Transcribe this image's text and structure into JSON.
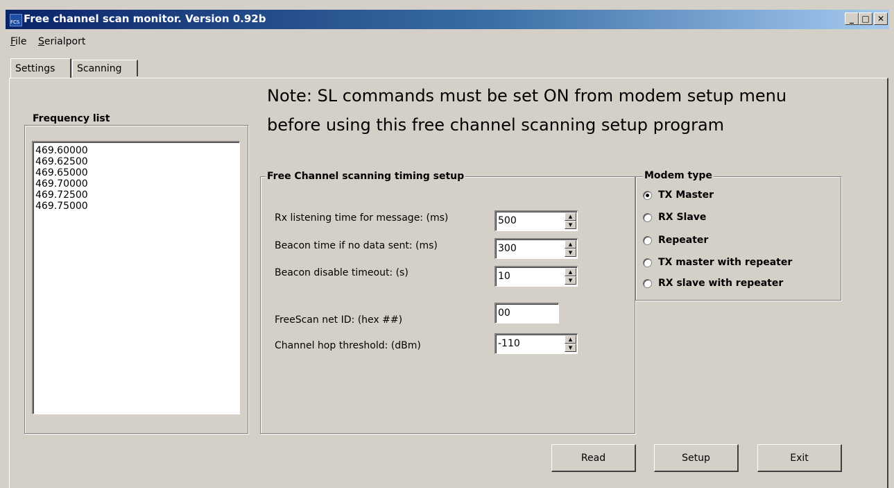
{
  "window": {
    "title": "Free channel scan monitor. Version 0.92b",
    "minimize": "_",
    "maximize": "□",
    "close": "✕"
  },
  "menu": {
    "file": "File",
    "file_accel": "F",
    "file_rest": "ile",
    "serialport_accel": "S",
    "serialport_rest": "erialport"
  },
  "tabs": {
    "settings": "Settings",
    "scanning": "Scanning"
  },
  "note": {
    "line1": "Note: SL commands must be set ON from modem setup menu",
    "line2": "before using this free channel scanning setup program"
  },
  "frequency": {
    "legend": "Frequency list",
    "items": [
      "469.60000",
      "469.62500",
      "469.65000",
      "469.70000",
      "469.72500",
      "469.75000"
    ]
  },
  "timing": {
    "legend": "Free Channel scanning timing setup",
    "rx_label": "Rx listening time for message: (ms)",
    "rx_value": "500",
    "beacon_label": "Beacon time if no data sent: (ms)",
    "beacon_value": "300",
    "beacon_disable_label": "Beacon disable timeout: (s)",
    "beacon_disable_value": "10",
    "netid_label": "FreeScan net ID: (hex ##)",
    "netid_value": "00",
    "hop_label": "Channel hop threshold: (dBm)",
    "hop_value": "-110"
  },
  "modem": {
    "legend": "Modem type",
    "options": [
      "TX Master",
      "RX Slave",
      "Repeater",
      "TX master with repeater",
      "RX slave with repeater"
    ],
    "selected": "TX Master"
  },
  "buttons": {
    "read": "Read",
    "setup": "Setup",
    "exit": "Exit"
  },
  "colors": {
    "face": "#d4d0c8",
    "title_start": "#0a246a",
    "title_end": "#a6caf0"
  },
  "icons": {
    "app": "fcs-app-icon",
    "spin_up": "triangle-up-icon",
    "spin_down": "triangle-down-icon"
  }
}
